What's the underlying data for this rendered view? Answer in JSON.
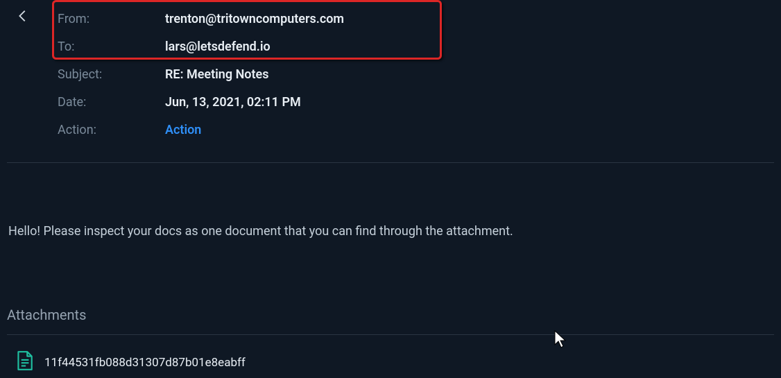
{
  "header": {
    "from_label": "From:",
    "from_value": "trenton@tritowncomputers.com",
    "to_label": "To:",
    "to_value": "lars@letsdefend.io",
    "subject_label": "Subject:",
    "subject_value": "RE: Meeting Notes",
    "date_label": "Date:",
    "date_value": "Jun, 13, 2021, 02:11 PM",
    "action_label": "Action:",
    "action_link": "Action"
  },
  "body": {
    "text": "Hello! Please inspect your docs as one document that you can find through the attachment."
  },
  "attachments": {
    "heading": "Attachments",
    "items": [
      {
        "name": "11f44531fb088d31307d87b01e8eabff"
      }
    ]
  },
  "highlight": {
    "color": "#dc2626"
  },
  "icons": {
    "back": "arrow-left-icon",
    "file": "file-icon",
    "cursor": "cursor-icon"
  }
}
